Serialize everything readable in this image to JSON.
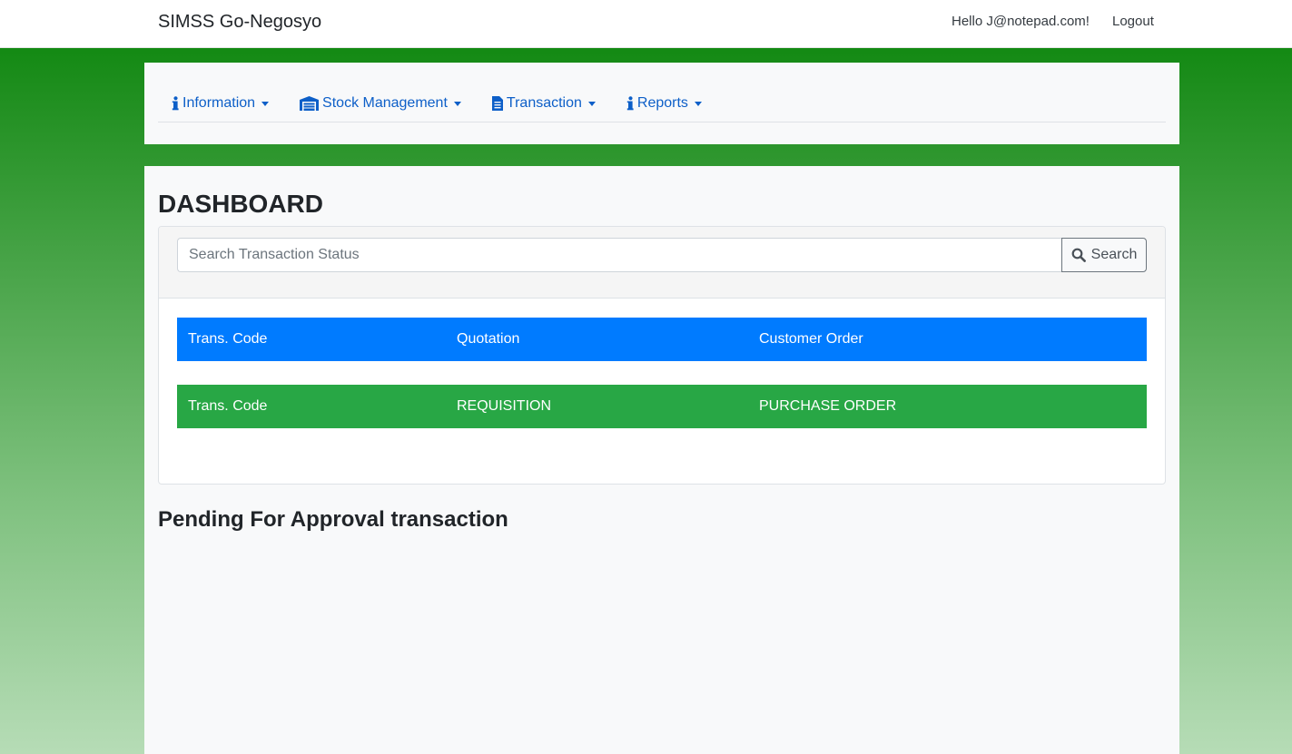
{
  "header": {
    "brand": "SIMSS Go-Negosyo",
    "greeting": "Hello J@notepad.com!",
    "logout_label": "Logout"
  },
  "nav": {
    "items": [
      {
        "label": "Information",
        "icon": "info-icon"
      },
      {
        "label": "Stock Management",
        "icon": "warehouse-icon"
      },
      {
        "label": "Transaction",
        "icon": "document-icon"
      },
      {
        "label": "Reports",
        "icon": "info-icon"
      }
    ]
  },
  "dashboard": {
    "title": "DASHBOARD",
    "search": {
      "placeholder": "Search Transaction Status",
      "value": "",
      "button_label": "Search"
    },
    "sales_row": {
      "col1": "Trans. Code",
      "col2": "Quotation",
      "col3": "Customer Order",
      "color": "#007bff"
    },
    "purchase_row": {
      "col1": "Trans. Code",
      "col2": "REQUISITION",
      "col3": "PURCHASE ORDER",
      "color": "#28a745"
    },
    "pending_title": "Pending For Approval transaction"
  },
  "colors": {
    "nav_link": "#0d5fc8",
    "background_green": "#138a13"
  }
}
